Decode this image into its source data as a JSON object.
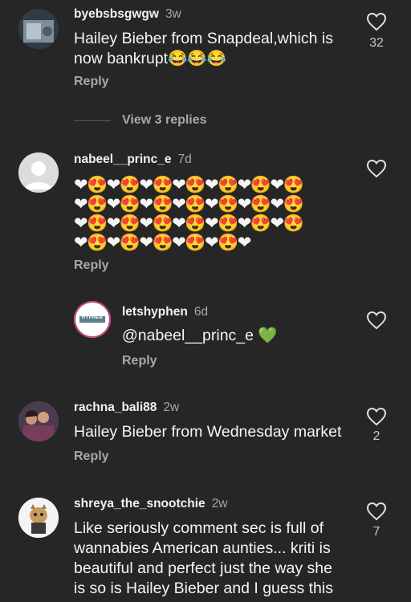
{
  "comments": [
    {
      "username": "byebsbsgwgw",
      "age": "3w",
      "text": "Hailey Bieber from Snapdeal,which is\nnow bankrupt😂😂😂",
      "reply_label": "Reply",
      "likes": "32",
      "view_replies": "View 3 replies"
    },
    {
      "username": "nabeel__princ_e",
      "age": "7d",
      "emoji_rows": [
        "❤😍❤😍❤😍❤😍❤😍❤😍❤😍",
        "❤😍❤😍❤😍❤😍❤😍❤😍❤😍",
        "❤😍❤😍❤😍❤😍❤😍❤😍❤😍",
        "❤😍❤😍❤😍❤😍❤😍❤"
      ],
      "reply_label": "Reply"
    },
    {
      "username": "letshyphen",
      "age": "6d",
      "text": "@nabeel__princ_e 💚",
      "reply_label": "Reply",
      "avatar_text": "HYPHEN"
    },
    {
      "username": "rachna_bali88",
      "age": "2w",
      "text": "Hailey Bieber from Wednesday market",
      "reply_label": "Reply",
      "likes": "2"
    },
    {
      "username": "shreya_the_snootchie",
      "age": "2w",
      "text": "Like seriously comment sec is full of\nwannabies American aunties... kriti is\nbeautiful and perfect just the way she\nis so is Hailey Bieber and I guess this",
      "likes": "7"
    }
  ],
  "icons": {
    "heart": "heart-outline-icon"
  },
  "colors": {
    "background": "#262626",
    "secondary_text": "#a8a8a8",
    "primary_text": "#f5f5f5"
  }
}
